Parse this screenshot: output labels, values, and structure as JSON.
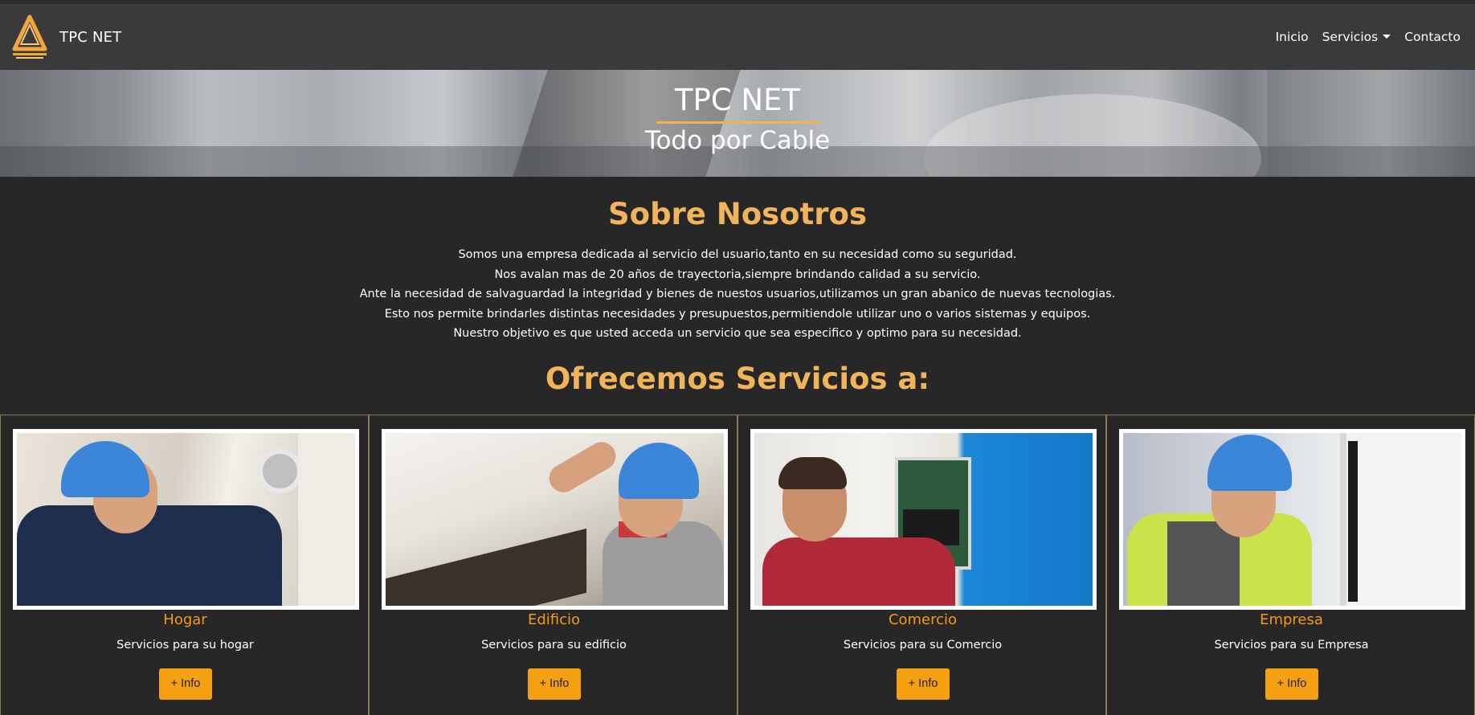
{
  "navbar": {
    "brand": "TPC NET",
    "links": {
      "inicio": "Inicio",
      "servicios": "Servicios",
      "contacto": "Contacto"
    }
  },
  "hero": {
    "title": "TPC NET",
    "subtitle": "Todo por Cable"
  },
  "about": {
    "title": "Sobre Nosotros",
    "lines": [
      "Somos una empresa dedicada al servicio del usuario,tanto en su necesidad como su seguridad.",
      "Nos avalan mas de 20 años de trayectoria,siempre brindando calidad a su servicio.",
      "Ante la necesidad de salvaguardad la integridad y bienes de nuestos usuarios,utilizamos un gran abanico de nuevas tecnologias.",
      "Esto nos permite brindarles distintas necesidades y presupuestos,permitiendole utilizar uno o varios sistemas y equipos.",
      "Nuestro objetivo es que usted acceda un servicio que sea especifico y optimo para su necesidad."
    ]
  },
  "services": {
    "title": "Ofrecemos Servicios a:",
    "cards": [
      {
        "title": "Hogar",
        "text": "Servicios para su hogar",
        "button": "+ Info"
      },
      {
        "title": "Edificio",
        "text": "Servicios para su edificio",
        "button": "+ Info"
      },
      {
        "title": "Comercio",
        "text": "Servicios para su Comercio",
        "button": "+ Info"
      },
      {
        "title": "Empresa",
        "text": "Servicios para su Empresa",
        "button": "+ Info"
      }
    ]
  },
  "colors": {
    "accent": "#f1b35b",
    "button": "#f59f12",
    "background": "#272727",
    "navbar": "#3a3a3a"
  }
}
